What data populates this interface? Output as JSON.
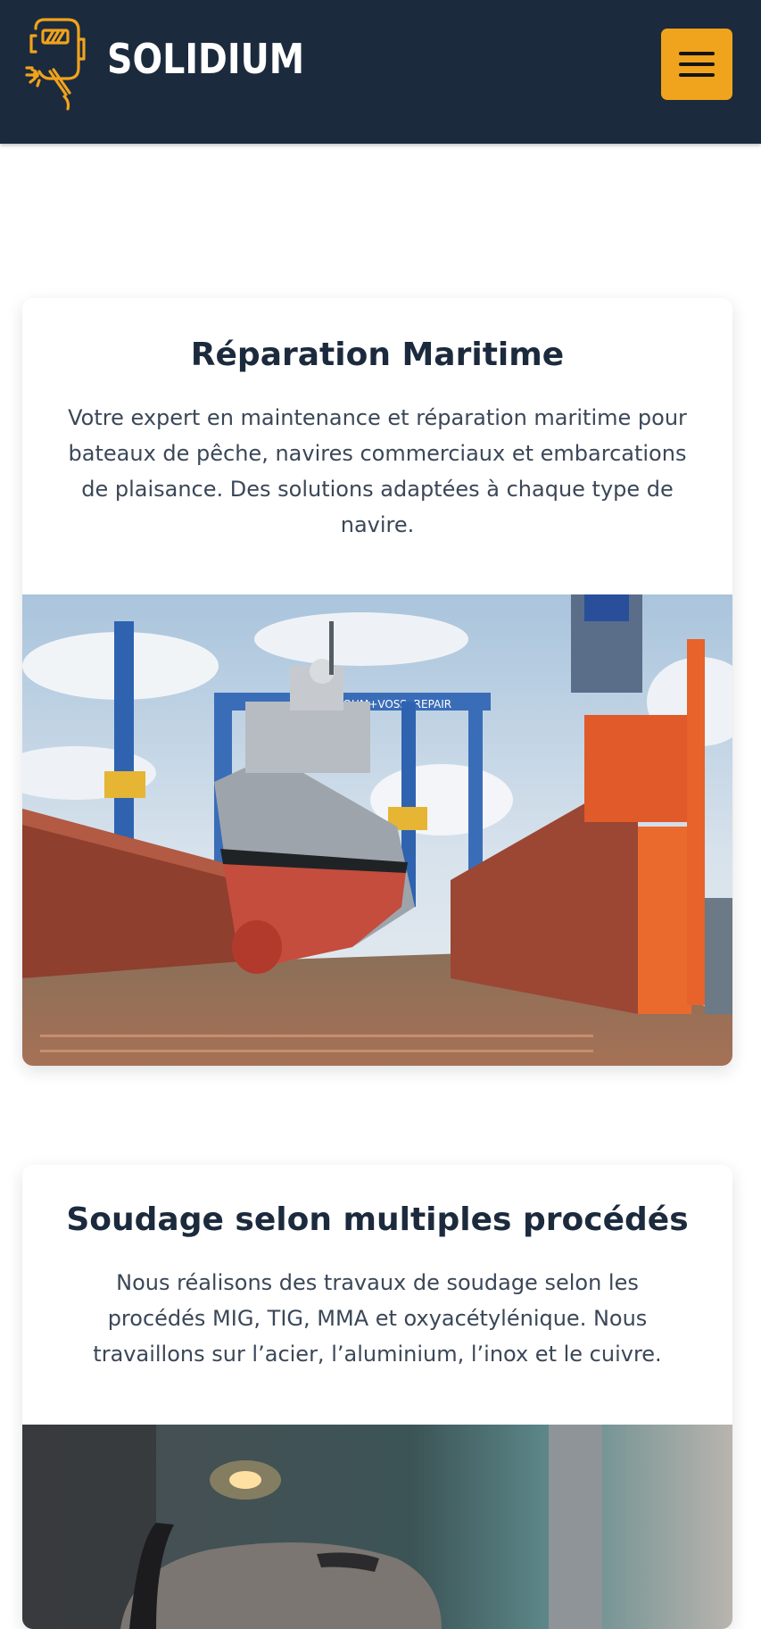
{
  "header": {
    "brand": "SOLIDIUM",
    "logo_icon": "welder-mask-icon",
    "menu_icon": "hamburger-icon",
    "colors": {
      "background": "#1c2a3d",
      "accent": "#f0a31c"
    }
  },
  "sections": [
    {
      "title": "Réparation Maritime",
      "text": "Votre expert en maintenance et réparation maritime pour bateaux de pêche, navires commerciaux et embarcations de plaisance. Des solutions adaptées à chaque type de navire.",
      "image_sign": "BLOHM+VOSS, REPAIR"
    },
    {
      "title": "Soudage selon multiples procédés",
      "text": "Nous réalisons des travaux de soudage selon les procédés MIG, TIG, MMA et oxyacétylénique. Nous travaillons sur l’acier, l’aluminium, l’inox et le cuivre."
    }
  ]
}
